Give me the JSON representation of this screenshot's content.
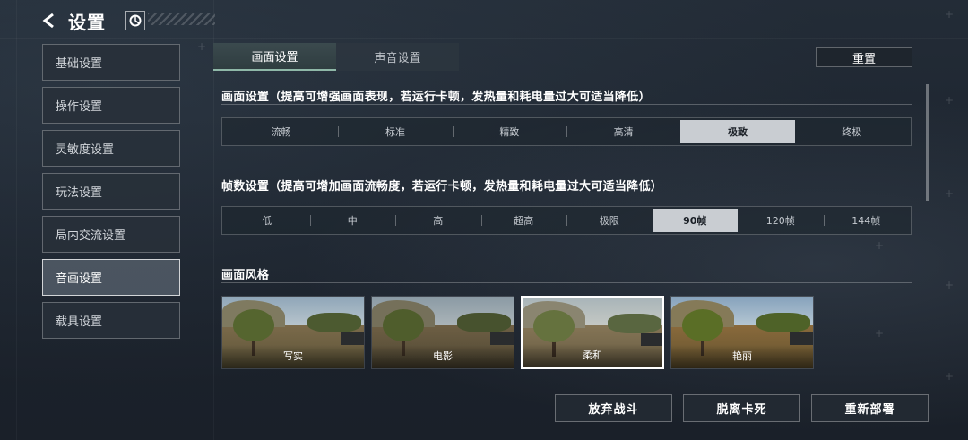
{
  "header": {
    "title": "设置",
    "back_icon": "back-arrow-icon",
    "logo_icon": "game-logo-icon"
  },
  "sidebar": {
    "items": [
      {
        "label": "基础设置",
        "active": false
      },
      {
        "label": "操作设置",
        "active": false
      },
      {
        "label": "灵敏度设置",
        "active": false
      },
      {
        "label": "玩法设置",
        "active": false
      },
      {
        "label": "局内交流设置",
        "active": false
      },
      {
        "label": "音画设置",
        "active": true
      },
      {
        "label": "载具设置",
        "active": false
      }
    ]
  },
  "tabs": [
    {
      "label": "画面设置",
      "active": true
    },
    {
      "label": "声音设置",
      "active": false
    }
  ],
  "reset_label": "重置",
  "graphics": {
    "title": "画面设置（提高可增强画面表现，若运行卡顿，发热量和耗电量过大可适当降低）",
    "options": [
      "流畅",
      "标准",
      "精致",
      "高清",
      "极致",
      "终极"
    ],
    "selected": "极致"
  },
  "framerate": {
    "title": "帧数设置（提高可增加画面流畅度，若运行卡顿，发热量和耗电量过大可适当降低）",
    "options": [
      "低",
      "中",
      "高",
      "超高",
      "极限",
      "90帧",
      "120帧",
      "144帧"
    ],
    "selected": "90帧"
  },
  "style": {
    "title": "画面风格",
    "options": [
      {
        "label": "写实",
        "active": false
      },
      {
        "label": "电影",
        "active": false
      },
      {
        "label": "柔和",
        "active": true
      },
      {
        "label": "艳丽",
        "active": false
      }
    ]
  },
  "bottom_buttons": {
    "abandon": "放弃战斗",
    "unstuck": "脱离卡死",
    "redeploy": "重新部署"
  },
  "colors": {
    "accent": "#8fb8a8",
    "selected_bg": "#c9cdd2",
    "panel_bg": "#1d2530"
  }
}
